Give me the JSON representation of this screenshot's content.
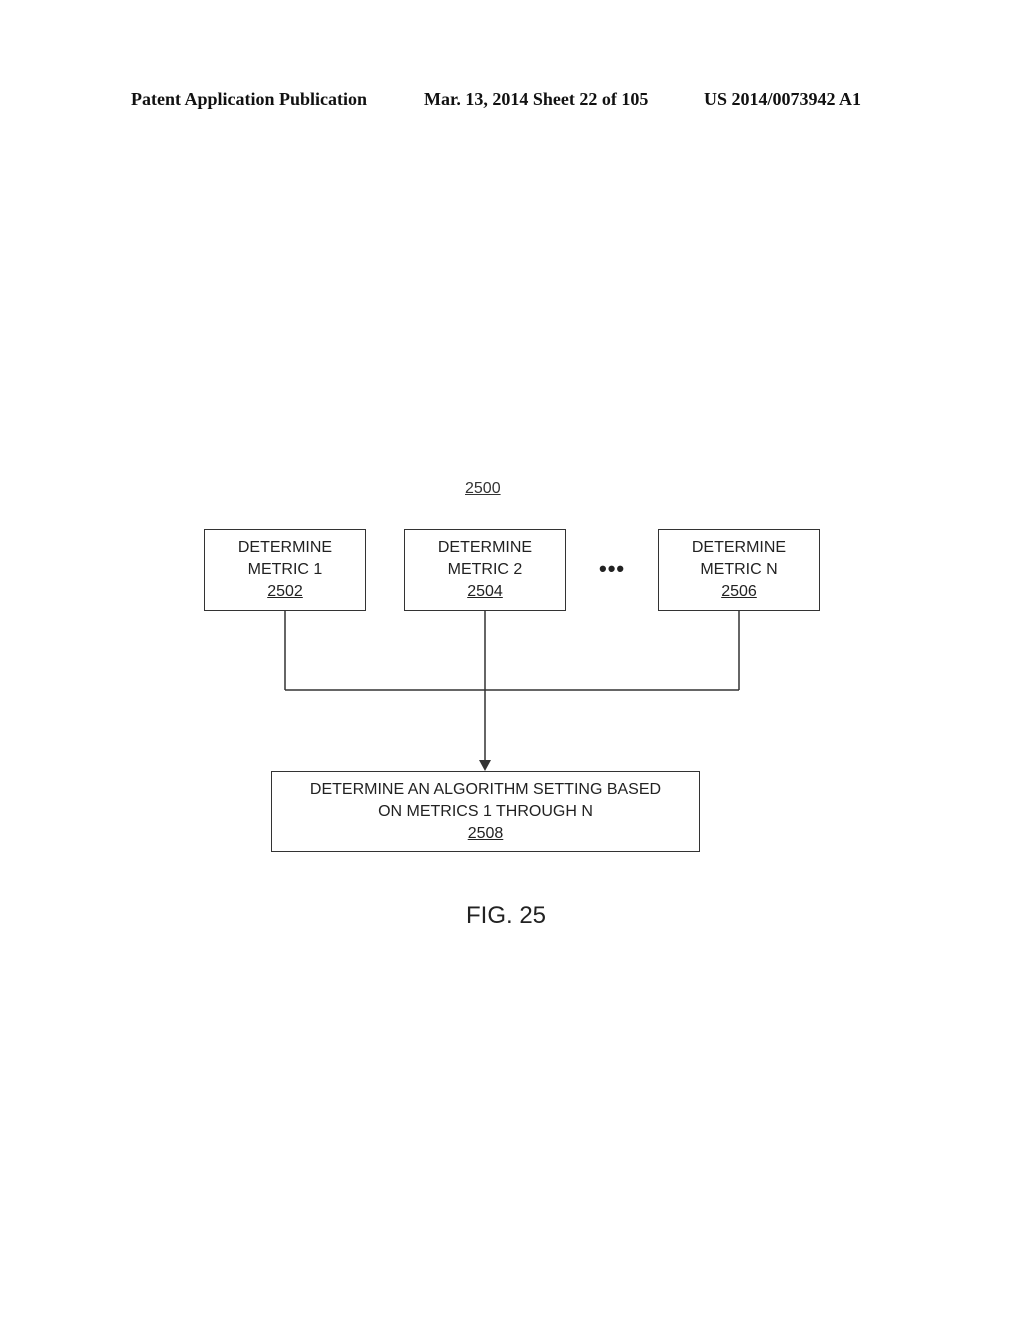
{
  "header": {
    "publication": "Patent Application Publication",
    "date_sheet": "Mar. 13, 2014  Sheet 22 of 105",
    "patent_number": "US 2014/0073942 A1"
  },
  "diagram": {
    "ref": "2500",
    "boxes": [
      {
        "line1": "DETERMINE",
        "line2": "METRIC 1",
        "ref": "2502"
      },
      {
        "line1": "DETERMINE",
        "line2": "METRIC 2",
        "ref": "2504"
      },
      {
        "line1": "DETERMINE",
        "line2": "METRIC N",
        "ref": "2506"
      }
    ],
    "ellipsis": "•••",
    "result_box": {
      "line1": "DETERMINE AN ALGORITHM SETTING BASED",
      "line2": "ON METRICS 1 THROUGH N",
      "ref": "2508"
    },
    "figure_label": "FIG. 25"
  }
}
